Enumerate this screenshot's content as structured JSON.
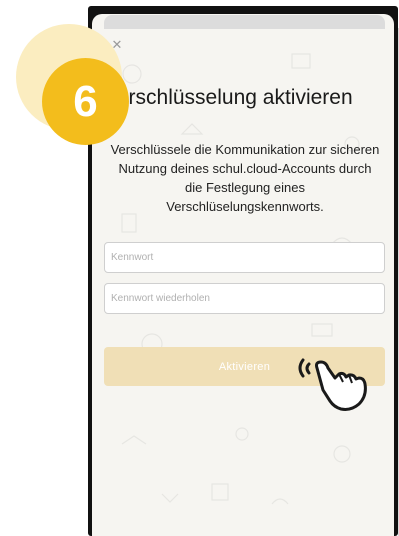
{
  "step_badge": {
    "number": "6",
    "color": "#f3bd1c"
  },
  "dialog": {
    "close_icon": "close-icon",
    "title": "Verschlüsselung aktivieren",
    "description": "Verschlüssele die Kommunikation zur sicheren Nutzung deines schul.cloud-Accounts durch die Festlegung eines Verschlüselungskennworts.",
    "password_field": {
      "placeholder": "Kennwort",
      "value": ""
    },
    "repeat_field": {
      "placeholder": "Kennwort wiederholen",
      "value": ""
    },
    "activate_button": {
      "label": "Aktivieren",
      "color": "#f0dfb6"
    }
  },
  "pointer": {
    "icon": "tapping-hand-icon"
  }
}
